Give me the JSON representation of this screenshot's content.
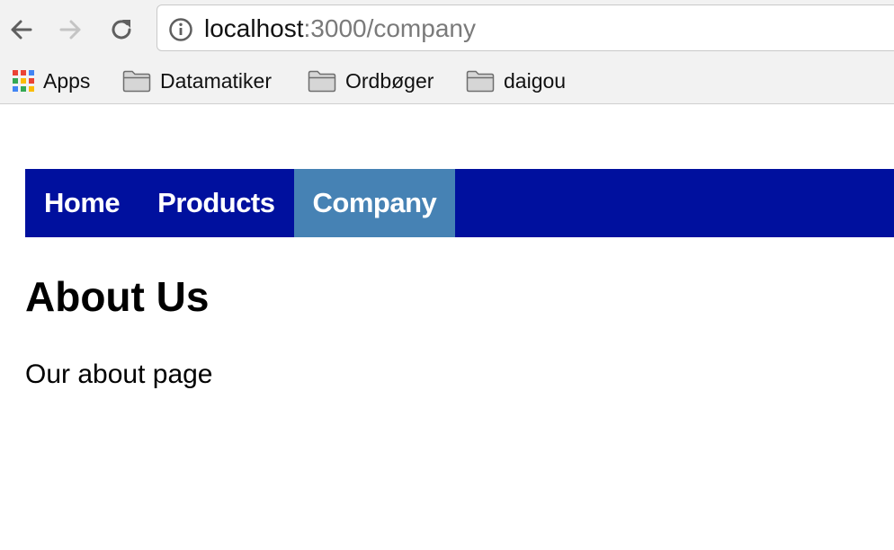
{
  "browser": {
    "url_host": "localhost",
    "url_rest": ":3000/company",
    "icons": {
      "back": "arrow-left-icon",
      "forward": "arrow-right-icon",
      "reload": "reload-icon",
      "info": "info-icon"
    }
  },
  "bookmarks": {
    "apps_label": "Apps",
    "items": [
      {
        "label": "Datamatiker",
        "icon": "folder-icon"
      },
      {
        "label": "Ordbøger",
        "icon": "folder-icon"
      },
      {
        "label": "daigou",
        "icon": "folder-icon"
      }
    ]
  },
  "nav": {
    "items": [
      {
        "label": "Home",
        "active": false
      },
      {
        "label": "Products",
        "active": false
      },
      {
        "label": "Company",
        "active": true
      }
    ],
    "bg_color": "#00109e",
    "active_color": "#4682b4"
  },
  "main": {
    "title": "About Us",
    "text": "Our about page"
  }
}
